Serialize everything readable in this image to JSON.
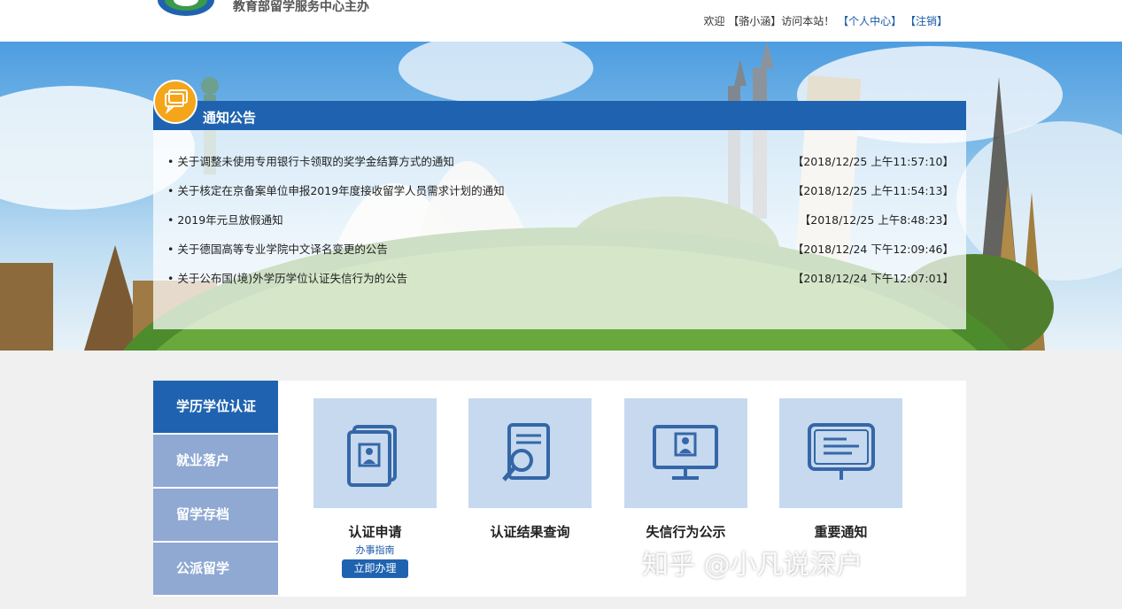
{
  "header": {
    "org_label": "教育部留学服务中心主办",
    "welcome": "欢迎 【骆小涵】访问本站！",
    "personal_center": "【个人中心】",
    "logout": "【注销】"
  },
  "notice": {
    "title": "通知公告",
    "items": [
      {
        "title": "• 关于调整未使用专用银行卡领取的奖学金结算方式的通知",
        "date": "【2018/12/25 上午11:57:10】"
      },
      {
        "title": "• 关于核定在京备案单位申报2019年度接收留学人员需求计划的通知",
        "date": "【2018/12/25 上午11:54:13】"
      },
      {
        "title": "• 2019年元旦放假通知",
        "date": "【2018/12/25 上午8:48:23】"
      },
      {
        "title": "• 关于德国高等专业学院中文译名变更的公告",
        "date": "【2018/12/24 下午12:09:46】"
      },
      {
        "title": "• 关于公布国(境)外学历学位认证失信行为的公告",
        "date": "【2018/12/24 下午12:07:01】"
      }
    ]
  },
  "sidebar": {
    "items": [
      {
        "label": "学历学位认证",
        "active": true
      },
      {
        "label": "就业落户"
      },
      {
        "label": "留学存档"
      },
      {
        "label": "公派留学"
      }
    ]
  },
  "cards": [
    {
      "label": "认证申请",
      "guide": "办事指南",
      "button": "立即办理",
      "icon": "document-id-icon"
    },
    {
      "label": "认证结果查询",
      "icon": "document-search-icon"
    },
    {
      "label": "失信行为公示",
      "icon": "monitor-person-icon"
    },
    {
      "label": "重要通知",
      "icon": "notice-board-icon"
    }
  ],
  "watermark": "知乎 @小凡说深户",
  "colors": {
    "primary": "#1f63b0",
    "sidebar_inactive": "#8fa9d3",
    "card_bg": "#c6d9ee",
    "accent_orange": "#f4a51a"
  }
}
